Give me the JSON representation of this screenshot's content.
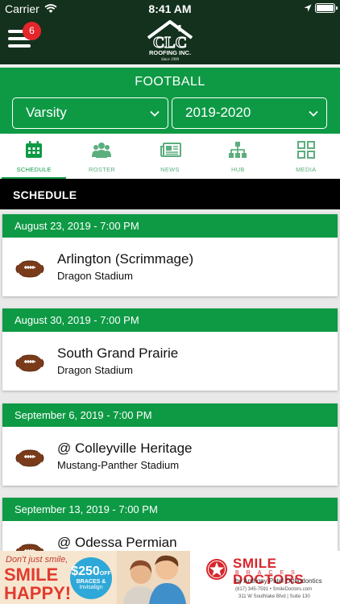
{
  "status_bar": {
    "carrier": "Carrier",
    "time": "8:41 AM"
  },
  "top_bar": {
    "notification_count": "6",
    "logo_text": "CLC",
    "logo_subtext": "ROOFING INC.",
    "logo_tagline": "Since 1999"
  },
  "team": {
    "title": "FOOTBALL",
    "level": "Varsity",
    "season": "2019-2020"
  },
  "tabs": [
    {
      "label": "SCHEDULE",
      "icon": "calendar-icon",
      "active": true
    },
    {
      "label": "ROSTER",
      "icon": "people-icon",
      "active": false
    },
    {
      "label": "NEWS",
      "icon": "newspaper-icon",
      "active": false
    },
    {
      "label": "HUB",
      "icon": "hierarchy-icon",
      "active": false
    },
    {
      "label": "MEDIA",
      "icon": "grid-icon",
      "active": false
    }
  ],
  "section": {
    "title": "SCHEDULE"
  },
  "games": [
    {
      "date": "August 23, 2019 - 7:00 PM",
      "opponent": "Arlington (Scrimmage)",
      "venue": "Dragon Stadium"
    },
    {
      "date": "August 30, 2019 - 7:00 PM",
      "opponent": "South Grand Prairie",
      "venue": "Dragon Stadium"
    },
    {
      "date": "September 6, 2019 - 7:00 PM",
      "opponent": "@ Colleyville Heritage",
      "venue": "Mustang-Panther Stadium"
    },
    {
      "date": "September 13, 2019 - 7:00 PM",
      "opponent": "@ Odessa Permian",
      "venue": ""
    }
  ],
  "ad": {
    "line1": "Don't just smile,",
    "line2": "SMILE",
    "line3": "HAPPY!",
    "offer_amount": "$250",
    "offer_suffix": "OFF",
    "offer_sub": "BRACES &",
    "offer_brand": "Invisalign",
    "brand": "SMILE DOCTORS",
    "brand_sub": "BRACES",
    "by_line": "by Anthony Patel Orthodontics",
    "contact": "(817) 345-7591 • SmileDoctors.com",
    "address": "311 W Southlake Blvd | Suite 130"
  },
  "colors": {
    "primary_green": "#0e9a45",
    "dark_green": "#13311d",
    "badge_red": "#e4262b"
  }
}
